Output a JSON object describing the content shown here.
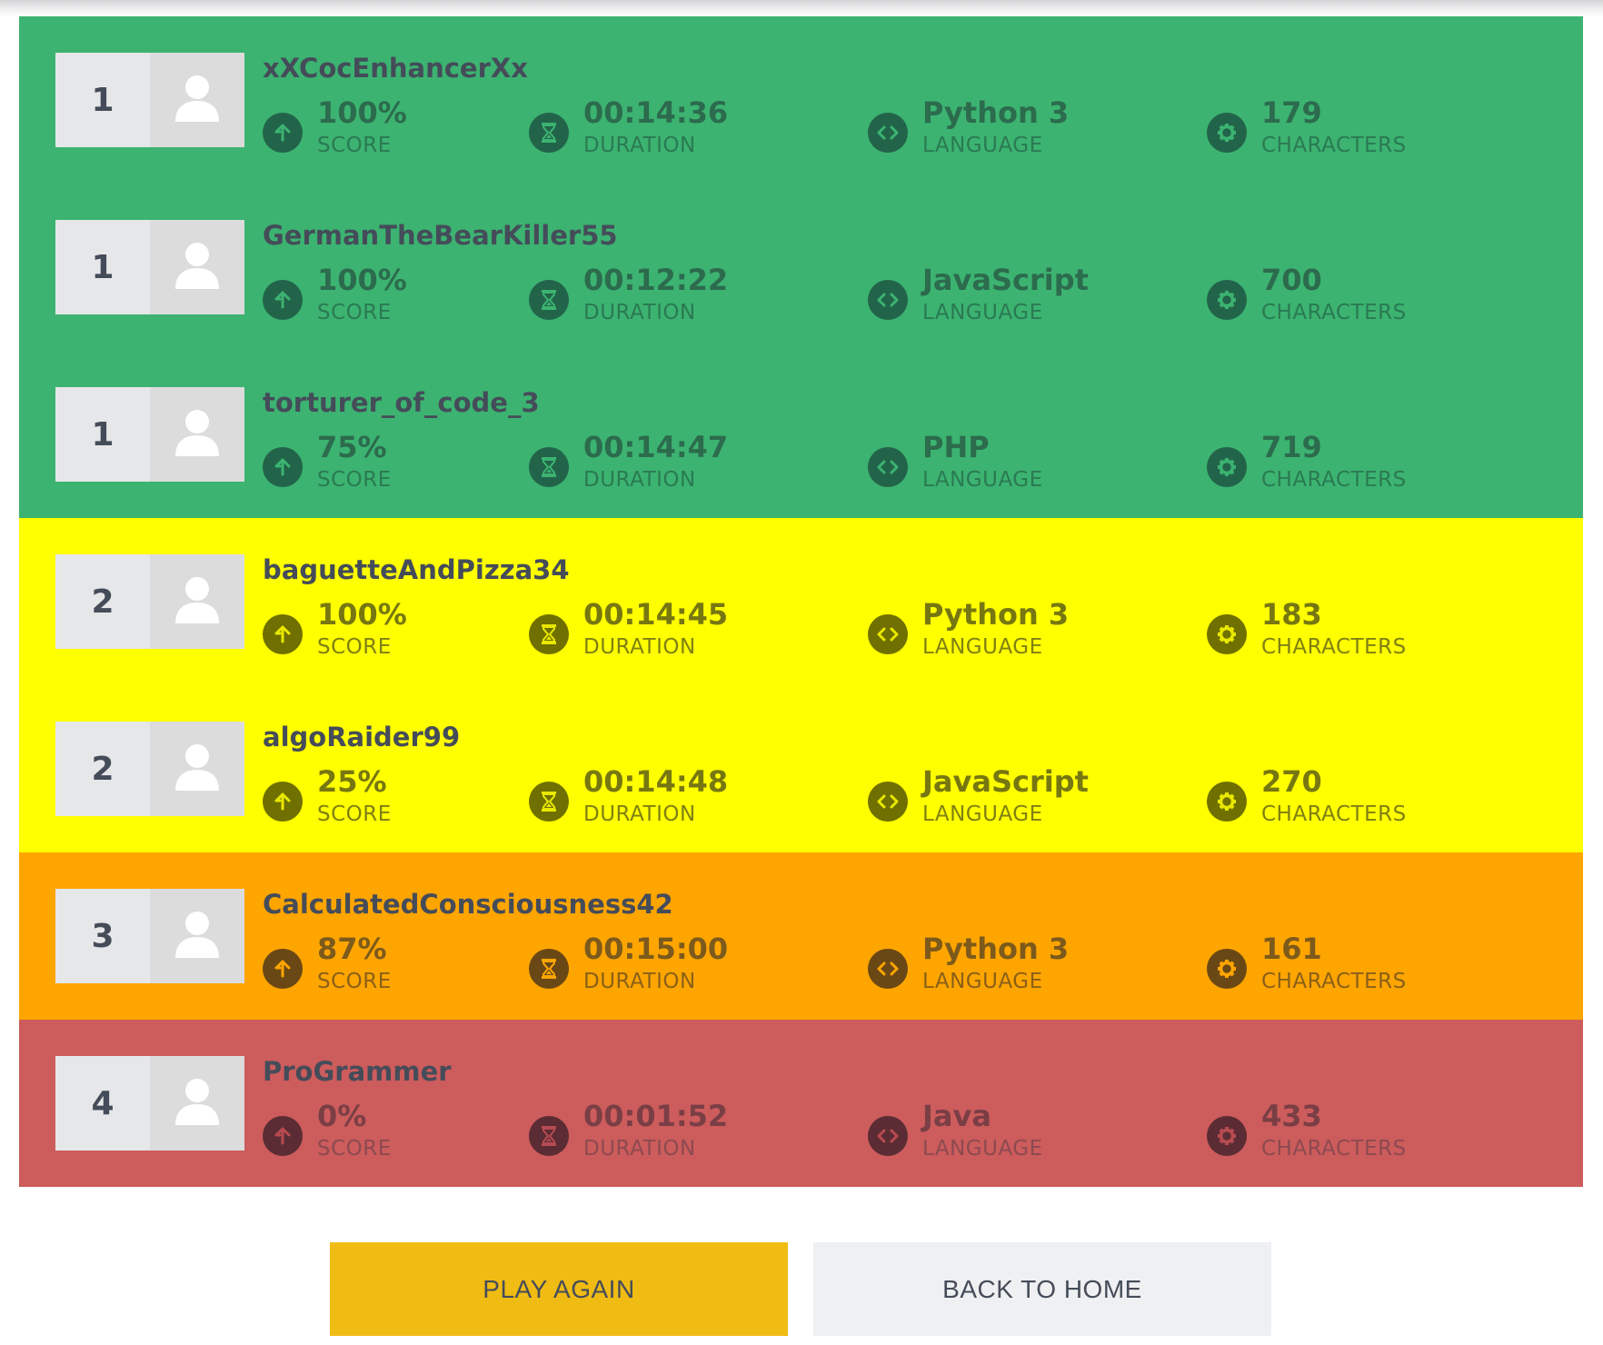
{
  "colors": {
    "green": "#3cb371",
    "yellow": "#ffff00",
    "orange": "#ffa500",
    "red": "#cd5c5c",
    "play_button": "#f0bc14",
    "home_button": "#eff0f2"
  },
  "labels": {
    "score": "SCORE",
    "duration": "DURATION",
    "language": "LANGUAGE",
    "characters": "CHARACTERS"
  },
  "icons": {
    "rank_avatar": "user-silhouette-icon",
    "score": "arrow-up-circle-icon",
    "duration": "hourglass-icon",
    "language": "code-brackets-icon",
    "characters": "gear-icon"
  },
  "players": [
    {
      "rank": "1",
      "name": "xXCocEnhancerXx",
      "score": "100%",
      "duration": "00:14:36",
      "language": "Python 3",
      "characters": "179",
      "tier": "green"
    },
    {
      "rank": "1",
      "name": "GermanTheBearKiller55",
      "score": "100%",
      "duration": "00:12:22",
      "language": "JavaScript",
      "characters": "700",
      "tier": "green"
    },
    {
      "rank": "1",
      "name": "torturer_of_code_3",
      "score": "75%",
      "duration": "00:14:47",
      "language": "PHP",
      "characters": "719",
      "tier": "green"
    },
    {
      "rank": "2",
      "name": "baguetteAndPizza34",
      "score": "100%",
      "duration": "00:14:45",
      "language": "Python 3",
      "characters": "183",
      "tier": "yellow"
    },
    {
      "rank": "2",
      "name": "algoRaider99",
      "score": "25%",
      "duration": "00:14:48",
      "language": "JavaScript",
      "characters": "270",
      "tier": "yellow"
    },
    {
      "rank": "3",
      "name": "CalculatedConsciousness42",
      "score": "87%",
      "duration": "00:15:00",
      "language": "Python 3",
      "characters": "161",
      "tier": "orange"
    },
    {
      "rank": "4",
      "name": "ProGrammer",
      "score": "0%",
      "duration": "00:01:52",
      "language": "Java",
      "characters": "433",
      "tier": "red"
    }
  ],
  "buttons": {
    "play_again": "PLAY AGAIN",
    "back_to_home": "BACK TO HOME"
  }
}
